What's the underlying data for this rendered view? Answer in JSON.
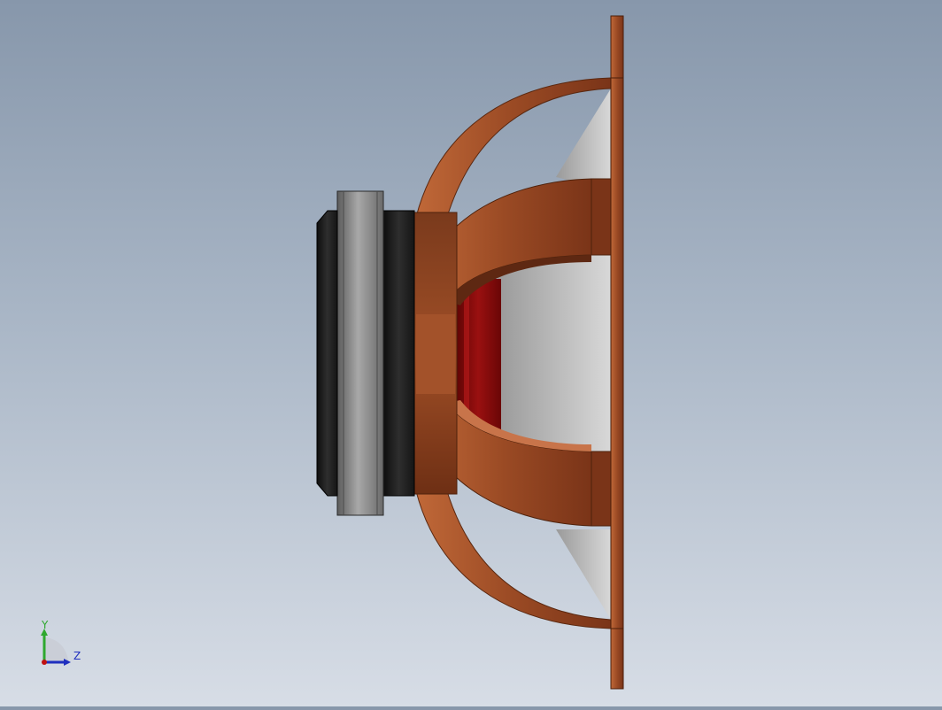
{
  "triad": {
    "y_label": "Y",
    "z_label": "Z",
    "colors": {
      "y": "#2ea82e",
      "z": "#1f2fbf",
      "origin": "#c01010"
    }
  },
  "colors": {
    "background_top": "#8797ab",
    "background_bottom": "#d7dde6",
    "frame_copper": "#a4502a",
    "frame_dark": "#6a2c14",
    "magnet_black": "#1c1c1c",
    "magnet_ring_gray": "#8a8a8a",
    "cone_gray": "#c6c6c6",
    "coil_red": "#8a0c0c"
  }
}
